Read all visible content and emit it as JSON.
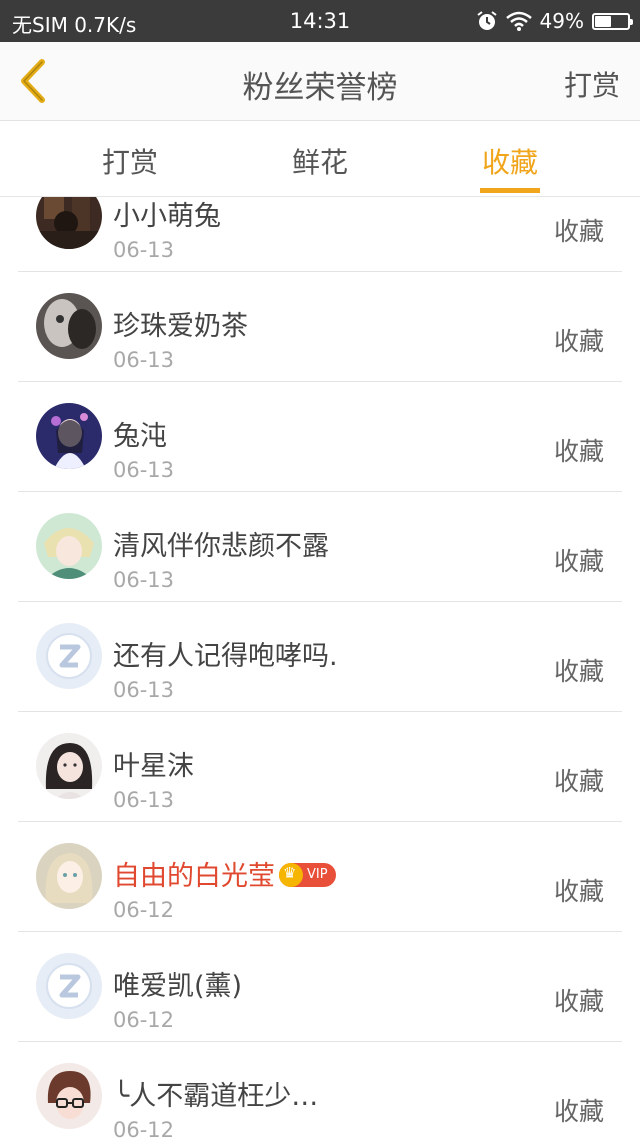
{
  "status_bar": {
    "carrier": "无SIM 0.7K/s",
    "time": "14:31",
    "battery_text": "49%",
    "battery_level": 0.49,
    "icons": [
      "alarm-icon",
      "wifi-icon",
      "battery-icon"
    ]
  },
  "header": {
    "title": "粉丝荣誉榜",
    "right_action": "打赏",
    "back_icon": "chevron-left-icon",
    "accent_color": "#f0a51b"
  },
  "tabs": [
    {
      "label": "打赏",
      "active": false
    },
    {
      "label": "鲜花",
      "active": false
    },
    {
      "label": "收藏",
      "active": true
    }
  ],
  "list": [
    {
      "name": "小小萌兔",
      "date": "06-13",
      "action": "收藏",
      "avatar": "photo-dark"
    },
    {
      "name": "珍珠爱奶茶",
      "date": "06-13",
      "action": "收藏",
      "avatar": "photo-grey"
    },
    {
      "name": "兔沌",
      "date": "06-13",
      "action": "收藏",
      "avatar": "photo-anime-blue"
    },
    {
      "name": "清风伴你悲颜不露",
      "date": "06-13",
      "action": "收藏",
      "avatar": "photo-anime-green"
    },
    {
      "name": "还有人记得咆哮吗.",
      "date": "06-13",
      "action": "收藏",
      "avatar": "default-qq"
    },
    {
      "name": "叶星沫",
      "date": "06-13",
      "action": "收藏",
      "avatar": "photo-girl"
    },
    {
      "name": "自由的白光莹",
      "date": "06-12",
      "action": "收藏",
      "avatar": "photo-anime-beige",
      "vip": true,
      "vip_label": "VIP"
    },
    {
      "name": "唯爱凯(薰)",
      "date": "06-12",
      "action": "收藏",
      "avatar": "default-qq"
    },
    {
      "name": "╰人不霸道枉少…",
      "date": "06-12",
      "action": "收藏",
      "avatar": "photo-glasses"
    }
  ]
}
